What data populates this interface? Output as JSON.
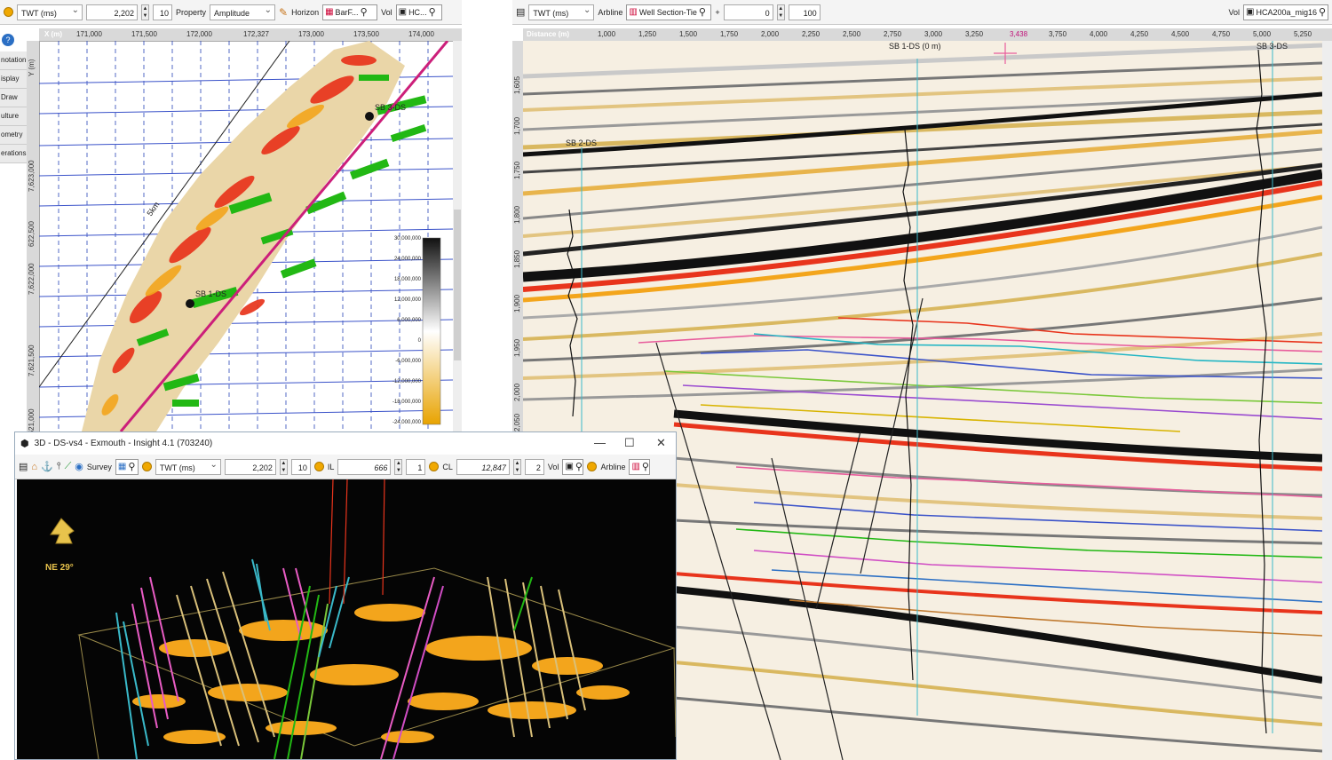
{
  "map_panel": {
    "toolbar": {
      "domain": "TWT (ms)",
      "time_value": "2,202",
      "step": "10",
      "property_label": "Property",
      "property_value": "Amplitude",
      "horizon_label": "Horizon",
      "horizon_value": "BarF...",
      "vol_label": "Vol",
      "vol_value": "HC..."
    },
    "x_axis_label": "X (m)",
    "x_ticks": [
      "171,000",
      "171,500",
      "172,000",
      "172,327",
      "173,000",
      "173,500",
      "174,000"
    ],
    "y_axis_label": "Y (m)",
    "y_ticks": [
      "7,623,000",
      "622,500",
      "7,622,000",
      "7,621,500",
      "7,621,000"
    ],
    "side_tabs": [
      "notation",
      "isplay",
      "Draw",
      "ulture",
      "ometry",
      "erations"
    ],
    "scale_label": "5km",
    "wells": [
      "SB 3-DS",
      "SB 1-DS"
    ],
    "colorbar_labels": [
      "30,000,000",
      "24,000,000",
      "18,000,000",
      "12,000,000",
      "6,000,000",
      "0",
      "-6,000,000",
      "-12,000,000",
      "-18,000,000",
      "-24,000,000"
    ],
    "colors": {
      "green": "#22b814",
      "red": "#e8341c",
      "orange": "#f3a51c",
      "beige": "#ead6a8",
      "track": "#cc1f7a"
    }
  },
  "section_panel": {
    "toolbar": {
      "domain": "TWT (ms)",
      "arbline_label": "Arbline",
      "arbline_value": "Well Section-Tie",
      "offset": "0",
      "length": "100",
      "vol_label": "Vol",
      "vol_value": "HCA200a_mig16"
    },
    "distance_label": "Distance (m)",
    "distance_ticks": [
      "1,000",
      "1,250",
      "1,500",
      "1,750",
      "2,000",
      "2,250",
      "2,500",
      "2,750",
      "3,000",
      "3,250",
      "3,438",
      "3,750",
      "4,000",
      "4,250",
      "4,500",
      "4,750",
      "5,000",
      "5,250"
    ],
    "twt_ticks": [
      "1,605",
      "1,700",
      "1,750",
      "1,800",
      "1,850",
      "1,900",
      "1,950",
      "2,000",
      "2,050"
    ],
    "wells": {
      "sb2": "SB 2-DS",
      "sb1": "SB 1-DS (0 m)",
      "sb3": "SB 3-DS"
    }
  },
  "view3d": {
    "title": "3D - DS-vs4 - Exmouth - Insight 4.1 (703240)",
    "toolbar": {
      "survey_label": "Survey",
      "domain": "TWT (ms)",
      "time_value": "2,202",
      "step": "10",
      "il_label": "IL",
      "il_value": "666",
      "il_step": "1",
      "cl_label": "CL",
      "cl_value": "12,847",
      "cl_step": "2",
      "vol_label": "Vol",
      "arbline_label": "Arbline"
    },
    "compass": "NE 29°",
    "controls": {
      "minimize": "—",
      "maximize": "☐",
      "close": "✕"
    }
  }
}
